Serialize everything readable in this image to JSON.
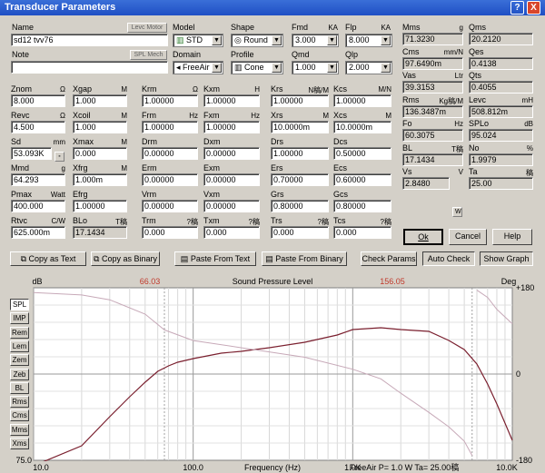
{
  "window": {
    "title": "Transducer Parameters",
    "help_glyph": "?",
    "close_glyph": "X"
  },
  "identity": {
    "name_label": "Name",
    "name_value": "sd12 tvv76",
    "name_button": "Levc Motor",
    "note_label": "Note",
    "note_value": "",
    "note_button": "SPL Mech"
  },
  "selectors": {
    "model_label": "Model",
    "model_value": "STD",
    "domain_label": "Domain",
    "domain_value": "FreeAir",
    "shape_label": "Shape",
    "shape_value": "Round",
    "profile_label": "Profile",
    "profile_value": "Cone",
    "fmd_label": "Fmd",
    "fmd_unit": "KA",
    "fmd_value": "3.000",
    "flp_label": "Flp",
    "flp_unit": "KA",
    "flp_value": "8.000",
    "qmd_label": "Qmd",
    "qmd_value": "1.000",
    "qlp_label": "Qlp",
    "qlp_value": "2.000"
  },
  "col1": [
    {
      "label": "Znom",
      "unit": "Ω",
      "value": "8.000"
    },
    {
      "label": "Revc",
      "unit": "Ω",
      "value": "4.500"
    },
    {
      "label": "Sd",
      "unit": "mm",
      "value": "53.093K"
    },
    {
      "label": "Mmd",
      "unit": "g",
      "value": "64.293"
    },
    {
      "label": "Pmax",
      "unit": "Watt",
      "value": "400.000"
    },
    {
      "label": "Rtvc",
      "unit": "C/W",
      "value": "625.000m"
    }
  ],
  "col2": [
    {
      "label": "Xgap",
      "unit": "M",
      "value": "1.000"
    },
    {
      "label": "Xcoil",
      "unit": "M",
      "value": "1.000"
    },
    {
      "label": "Xmax",
      "unit": "M",
      "value": "0.000"
    },
    {
      "label": "Xfrg",
      "unit": "M",
      "value": "1.000m"
    },
    {
      "label": "Efrg",
      "unit": "",
      "value": "1.00000"
    },
    {
      "label": "BLo",
      "unit": "T稿",
      "value": "17.1434"
    }
  ],
  "col3": [
    {
      "label": "Krm",
      "unit": "Ω",
      "value": "1.00000"
    },
    {
      "label": "Frm",
      "unit": "Hz",
      "value": "1.00000"
    },
    {
      "label": "Drm",
      "unit": "",
      "value": "0.00000"
    },
    {
      "label": "Erm",
      "unit": "",
      "value": "0.00000"
    },
    {
      "label": "Vrm",
      "unit": "",
      "value": "0.00000"
    },
    {
      "label": "Trm",
      "unit": "?稿",
      "value": "0.000"
    }
  ],
  "col4": [
    {
      "label": "Kxm",
      "unit": "H",
      "value": "1.00000"
    },
    {
      "label": "Fxm",
      "unit": "Hz",
      "value": "1.00000"
    },
    {
      "label": "Dxm",
      "unit": "",
      "value": "0.00000"
    },
    {
      "label": "Exm",
      "unit": "",
      "value": "0.00000"
    },
    {
      "label": "Vxm",
      "unit": "",
      "value": "0.00000"
    },
    {
      "label": "Txm",
      "unit": "?稿",
      "value": "0.000"
    }
  ],
  "col5": [
    {
      "label": "Krs",
      "unit": "N稿/M",
      "value": "1.00000"
    },
    {
      "label": "Xrs",
      "unit": "M",
      "value": "10.0000m"
    },
    {
      "label": "Drs",
      "unit": "",
      "value": "1.00000"
    },
    {
      "label": "Ers",
      "unit": "",
      "value": "0.70000"
    },
    {
      "label": "Grs",
      "unit": "",
      "value": "0.80000"
    },
    {
      "label": "Trs",
      "unit": "?稿",
      "value": "0.000"
    }
  ],
  "col6": [
    {
      "label": "Kcs",
      "unit": "M/N",
      "value": "1.00000"
    },
    {
      "label": "Xcs",
      "unit": "M",
      "value": "10.0000m"
    },
    {
      "label": "Dcs",
      "unit": "",
      "value": "0.50000"
    },
    {
      "label": "Ecs",
      "unit": "",
      "value": "0.60000"
    },
    {
      "label": "Gcs",
      "unit": "",
      "value": "0.80000"
    },
    {
      "label": "Tcs",
      "unit": "?稿",
      "value": "0.000"
    }
  ],
  "right_left": [
    {
      "label": "Mms",
      "unit": "g",
      "value": "71.3230"
    },
    {
      "label": "Cms",
      "unit": "mm/N",
      "value": "97.6490m"
    },
    {
      "label": "Vas",
      "unit": "Ltr",
      "value": "39.3153"
    },
    {
      "label": "Rms",
      "unit": "Kg稿/M",
      "value": "136.3487m"
    },
    {
      "label": "Fo",
      "unit": "Hz",
      "value": "60.3075"
    },
    {
      "label": "BL",
      "unit": "T稿",
      "value": "17.1434"
    },
    {
      "label": "Vs",
      "unit": "V",
      "value": "2.8480"
    }
  ],
  "right_right": [
    {
      "label": "Qms",
      "unit": "",
      "value": "20.2120"
    },
    {
      "label": "Qes",
      "unit": "",
      "value": "0.4138"
    },
    {
      "label": "Qts",
      "unit": "",
      "value": "0.4055"
    },
    {
      "label": "Levc",
      "unit": "mH",
      "value": "508.812m"
    },
    {
      "label": "SPLo",
      "unit": "dB",
      "value": "95.024"
    },
    {
      "label": "No",
      "unit": "%",
      "value": "1.9979"
    },
    {
      "label": "Ta",
      "unit": "稿",
      "value": "25.00"
    }
  ],
  "vs_suffix": "W",
  "dialog_buttons": {
    "ok": "Ok",
    "cancel": "Cancel",
    "help": "Help"
  },
  "action_buttons": {
    "copy_text": "Copy as Text",
    "copy_binary": "Copy as Binary",
    "paste_text": "Paste From Text",
    "paste_binary": "Paste From Binary",
    "check": "Check Params",
    "auto": "Auto Check",
    "graph": "Show Graph"
  },
  "side_tabs": [
    "SPL",
    "IMP",
    "Rem",
    "Lem",
    "Zem",
    "Zeb",
    "BL",
    "Rms",
    "Cms",
    "Mms",
    "Xms"
  ],
  "colors": {
    "spl_curve": "#7a1f2e",
    "phase_curve": "#c7a9b8",
    "marker_text": "#c0392b"
  },
  "chart_data": {
    "type": "line",
    "title": "Sound Pressure Level",
    "xlabel": "Frequency (Hz)",
    "ylabel_left": "dB",
    "ylabel_right": "Deg",
    "x_scale": "log",
    "xlim": [
      10,
      10000
    ],
    "ylim": [
      75,
      170
    ],
    "ylim_right": [
      -180,
      180
    ],
    "x_tick_labels": [
      "10.0",
      "100.0",
      "1.0K",
      "10.0K"
    ],
    "x_ticks": [
      10,
      100,
      1000,
      10000
    ],
    "y_tick_labels_left": [
      "75.0"
    ],
    "y_tick_labels_right": [
      "+180",
      "0",
      "-180"
    ],
    "y_ticks_right": [
      180,
      0,
      -180
    ],
    "markers": [
      {
        "x": 66.03,
        "label": "66.03"
      },
      {
        "x": 5600,
        "label": "156.05"
      }
    ],
    "footer": "FreeAir  P=  1.0 W  Ta=  25.00稿",
    "grid": true,
    "series": [
      {
        "name": "SPL",
        "axis": "left",
        "x": [
          10,
          20,
          30,
          40,
          50,
          60,
          70,
          80,
          100,
          150,
          200,
          300,
          500,
          800,
          1000,
          1500,
          2000,
          3000,
          4000,
          5000,
          6000,
          7000,
          8000,
          10000
        ],
        "y": [
          72,
          83,
          99,
          110,
          118,
          124,
          127,
          129,
          131,
          134,
          135,
          137,
          140,
          144,
          147,
          148,
          147,
          146,
          141,
          136,
          128,
          117,
          106,
          86
        ]
      },
      {
        "name": "Phase",
        "axis": "right",
        "x": [
          10,
          20,
          30,
          50,
          66,
          100,
          200,
          500,
          1000,
          1500,
          2000,
          3000,
          4000,
          5000,
          5600,
          6000,
          7000,
          8000,
          10000
        ],
        "y": [
          170,
          165,
          155,
          125,
          92,
          70,
          55,
          35,
          10,
          -10,
          -40,
          -80,
          -110,
          -140,
          -170,
          175,
          160,
          135,
          105
        ]
      }
    ]
  }
}
